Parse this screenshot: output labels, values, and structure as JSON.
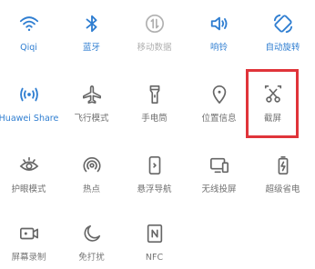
{
  "tiles": [
    {
      "label": "Qiqi",
      "icon": "wifi-icon",
      "state": "on"
    },
    {
      "label": "蓝牙",
      "icon": "bluetooth-icon",
      "state": "on"
    },
    {
      "label": "移动数据",
      "icon": "mobile-data-icon",
      "state": "dim"
    },
    {
      "label": "响铃",
      "icon": "speaker-icon",
      "state": "on"
    },
    {
      "label": "自动旋转",
      "icon": "auto-rotate-icon",
      "state": "on"
    },
    {
      "label": "Huawei Share",
      "icon": "huawei-share-icon",
      "state": "on"
    },
    {
      "label": "飞行模式",
      "icon": "airplane-icon",
      "state": "off"
    },
    {
      "label": "手电筒",
      "icon": "flashlight-icon",
      "state": "off"
    },
    {
      "label": "位置信息",
      "icon": "location-icon",
      "state": "off"
    },
    {
      "label": "截屏",
      "icon": "scissors-icon",
      "state": "off"
    },
    {
      "label": "护眼模式",
      "icon": "eye-icon",
      "state": "off"
    },
    {
      "label": "热点",
      "icon": "hotspot-icon",
      "state": "off"
    },
    {
      "label": "悬浮导航",
      "icon": "floating-nav-icon",
      "state": "off"
    },
    {
      "label": "无线投屏",
      "icon": "wireless-projection-icon",
      "state": "off"
    },
    {
      "label": "超级省电",
      "icon": "battery-saver-icon",
      "state": "off"
    },
    {
      "label": "屏幕录制",
      "icon": "screen-record-icon",
      "state": "off"
    },
    {
      "label": "免打扰",
      "icon": "moon-icon",
      "state": "off"
    },
    {
      "label": "NFC",
      "icon": "nfc-icon",
      "state": "off"
    }
  ],
  "highlight_color": "#e0343a",
  "active_color": "#2f7ed1",
  "inactive_color": "#666666"
}
